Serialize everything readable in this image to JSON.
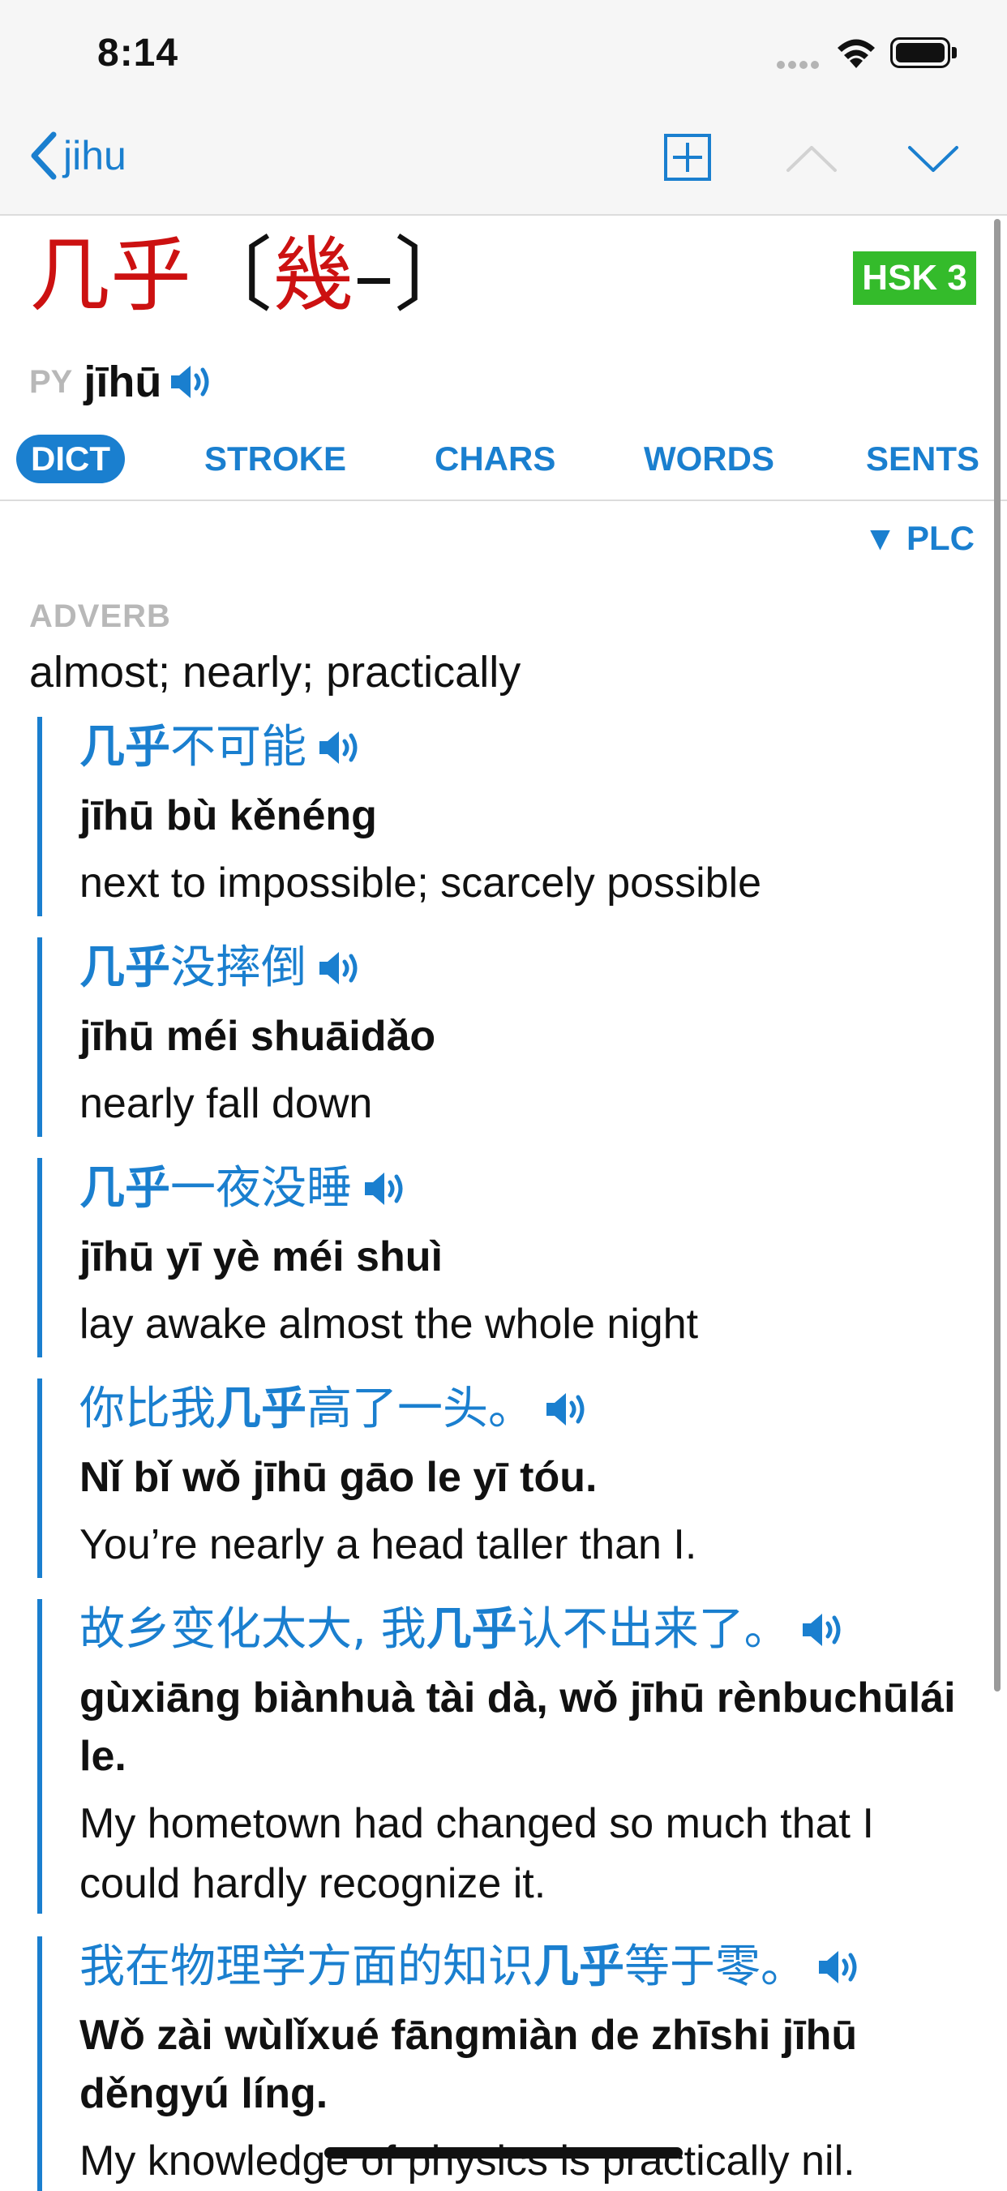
{
  "status": {
    "time": "8:14"
  },
  "nav": {
    "back_label": "jihu"
  },
  "entry": {
    "simplified": "几乎",
    "trad_open": "〔",
    "trad_chars": "幾",
    "trad_rest": "–",
    "trad_close": "〕",
    "hsk": "HSK 3",
    "py_label": "PY",
    "pinyin": "jīhū"
  },
  "tabs": [
    "DICT",
    "STROKE",
    "CHARS",
    "WORDS",
    "SENTS"
  ],
  "plc": "▼ PLC",
  "pos": "ADVERB",
  "gloss": "almost; nearly; practically",
  "examples": [
    {
      "zh_pre": "",
      "zh_hl": "几乎",
      "zh_post": "不可能",
      "py_pre": "",
      "py_hl": "jīhū",
      "py_post": " bù kěnéng",
      "en": "next to impossible; scarcely possible"
    },
    {
      "zh_pre": "",
      "zh_hl": "几乎",
      "zh_post": "没摔倒",
      "py_pre": "",
      "py_hl": "jīhū",
      "py_post": " méi shuāidǎo",
      "en": "nearly fall down"
    },
    {
      "zh_pre": "",
      "zh_hl": "几乎",
      "zh_post": "一夜没睡",
      "py_pre": "",
      "py_hl": "jīhū",
      "py_post": " yī yè méi shuì",
      "en": "lay awake almost the whole night"
    },
    {
      "zh_pre": "你比我",
      "zh_hl": "几乎",
      "zh_post": "高了一头。",
      "py_pre": "Nǐ bǐ wǒ ",
      "py_hl": "jīhū",
      "py_post": " gāo le yī tóu.",
      "en": "You’re nearly a head taller than I."
    },
    {
      "zh_pre": "故乡变化太大, 我",
      "zh_hl": "几乎",
      "zh_post": "认不出来了。",
      "py_pre": "gùxiāng biànhuà tài dà, wǒ ",
      "py_hl": "jīhū",
      "py_post": " rènbuchūlái le.",
      "en": "My hometown had changed so much that I could hardly recognize it."
    },
    {
      "zh_pre": "我在物理学方面的知识",
      "zh_hl": "几乎",
      "zh_post": "等于零。",
      "py_pre": "Wǒ zài wùlǐxué fāngmiàn de zhīshi ",
      "py_hl": "jīhū",
      "py_post": " děngyú líng.",
      "en": "My knowledge of physics is practically nil."
    }
  ],
  "colors": {
    "accent": "#1a7fcf",
    "headword": "#cc1111",
    "hsk_badge": "#34bb2b"
  }
}
